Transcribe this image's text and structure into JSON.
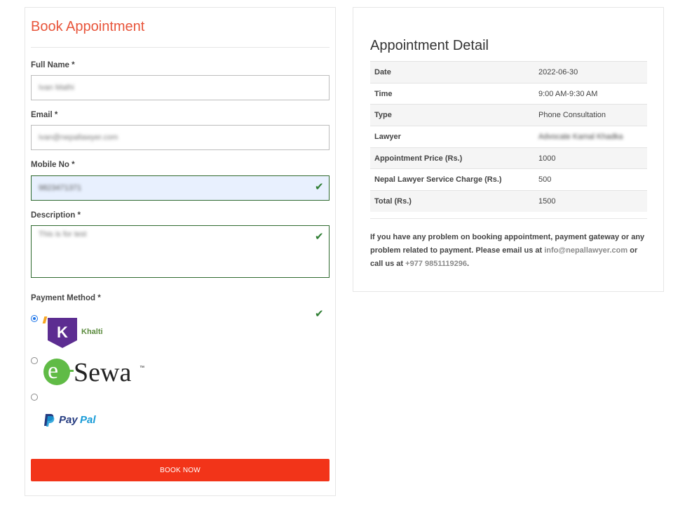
{
  "form": {
    "title": "Book Appointment",
    "full_name": {
      "label": "Full Name *",
      "value": "Ivan Mathi"
    },
    "email": {
      "label": "Email *",
      "value": "ivan@nepallawyer.com"
    },
    "mobile": {
      "label": "Mobile No *",
      "value": "9823471371"
    },
    "description": {
      "label": "Description *",
      "value": "This is for test"
    },
    "payment": {
      "label": "Payment Method *",
      "options": [
        {
          "name": "Khalti",
          "logo_letter": "K",
          "selected": true
        },
        {
          "name": "eSewa",
          "logo_letter": "e",
          "logo_text": "Sewa",
          "tm": "™",
          "selected": false
        },
        {
          "name": "PayPal",
          "logo_text_1": "Pay",
          "logo_text_2": "Pal",
          "selected": false
        }
      ]
    },
    "submit_label": "Book Now"
  },
  "detail": {
    "title": "Appointment Detail",
    "rows": [
      {
        "key": "Date",
        "value": "2022-06-30"
      },
      {
        "key": "Time",
        "value": "9:00 AM-9:30 AM"
      },
      {
        "key": "Type",
        "value": "Phone Consultation"
      },
      {
        "key": "Lawyer",
        "value": "Advocate Kamal Khadka"
      },
      {
        "key": "Appointment Price (Rs.)",
        "value": "1000"
      },
      {
        "key": "Nepal Lawyer Service Charge (Rs.)",
        "value": "500"
      },
      {
        "key": "Total (Rs.)",
        "value": "1500"
      }
    ],
    "note": {
      "text_1": "If you have any problem on booking appointment, payment gateway or any problem related to payment. Please email us at",
      "email": "info@nepallawyer.com",
      "text_2": "or call us at",
      "phone": "+977 9851119296",
      "text_3": "."
    }
  },
  "colors": {
    "accent": "#e8553b",
    "button": "#f23419",
    "valid": "#2e7d32",
    "khalti": "#5c2d91",
    "esewa_green": "#60bb46",
    "paypal_dark": "#253b80",
    "paypal_light": "#179bd7"
  }
}
